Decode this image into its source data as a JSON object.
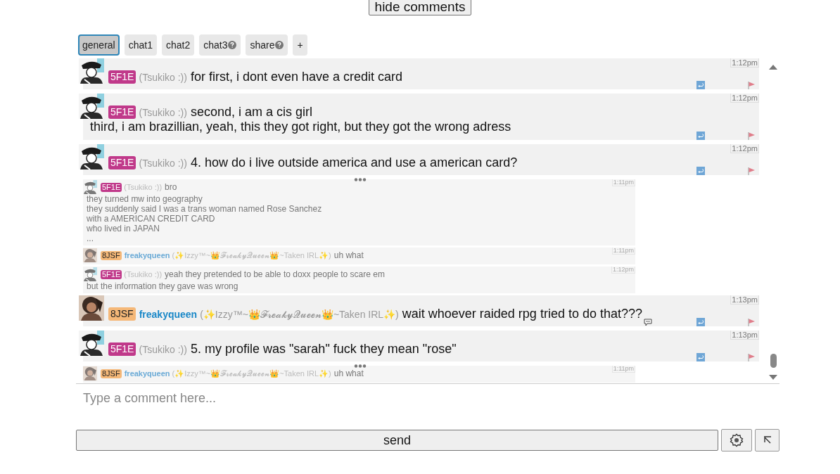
{
  "toggle_button": "hide comments",
  "tabs": [
    {
      "label": "general",
      "help": false,
      "selected": true
    },
    {
      "label": "chat1",
      "help": false,
      "selected": false
    },
    {
      "label": "chat2",
      "help": false,
      "selected": false
    },
    {
      "label": "chat3",
      "help": true,
      "selected": false
    },
    {
      "label": "share",
      "help": true,
      "selected": false
    },
    {
      "label": "+",
      "help": false,
      "selected": false
    }
  ],
  "messages": [
    {
      "kind": "main",
      "badge": "5F1E",
      "color": "#c0398a",
      "display_name": "(Tsukiko :))",
      "time": "1:12pm",
      "lines": [
        "for first, i dont even have a credit card"
      ],
      "comment_icon": false
    },
    {
      "kind": "main",
      "badge": "5F1E",
      "color": "#c0398a",
      "display_name": "(Tsukiko :))",
      "time": "1:12pm",
      "lines": [
        "second, i am a cis girl",
        "third, i am brazillian, yeah, this they got right, but they got the wrong adress"
      ],
      "comment_icon": false
    },
    {
      "kind": "main",
      "badge": "5F1E",
      "color": "#c0398a",
      "display_name": "(Tsukiko :))",
      "time": "1:12pm",
      "lines": [
        "4. how do i live outside america and use a american card?"
      ],
      "comment_icon": false
    },
    {
      "kind": "quoted",
      "badge": "5F1E",
      "color": "#c0398a",
      "display_name": "(Tsukiko :))",
      "time": "1:11pm",
      "lines": [
        "bro",
        "they turned mw into geography",
        "they suddenly said I was a trans woman named Rose Sanchez",
        "with a AMERICAN CREDIT CARD",
        "who lived in JAPAN",
        "..."
      ],
      "more_handle": true
    },
    {
      "kind": "quoted",
      "badge": "8JSF",
      "color": "#f5b878",
      "username": "freakyqueen",
      "display_name": "(✨Izzy™~👑𝓕𝓻𝓮𝓪𝓴𝔂𝓠𝓾𝓮𝓮𝓷👑~Taken IRL✨)",
      "time": "1:11pm",
      "lines": [
        "uh what"
      ],
      "more_handle": false
    },
    {
      "kind": "quoted",
      "badge": "5F1E",
      "color": "#c0398a",
      "display_name": "(Tsukiko :))",
      "time": "1:12pm",
      "lines": [
        "yeah they pretended to be able to doxx people to scare em",
        "but the information they gave was wrong"
      ],
      "more_handle": false
    },
    {
      "kind": "main",
      "badge": "8JSF",
      "color": "#f5b878",
      "username": "freakyqueen",
      "display_name": "(✨Izzy™~👑𝓕𝓻𝓮𝓪𝓴𝔂𝓠𝓾𝓮𝓮𝓷👑~Taken IRL✨)",
      "time": "1:13pm",
      "lines": [
        "wait whoever raided rpg tried to do that???"
      ],
      "comment_icon": true
    },
    {
      "kind": "main",
      "badge": "5F1E",
      "color": "#c0398a",
      "display_name": "(Tsukiko :))",
      "time": "1:13pm",
      "lines": [
        "5. my profile was \"sarah\" fuck they mean \"rose\""
      ],
      "comment_icon": false
    },
    {
      "kind": "quoted",
      "badge": "8JSF",
      "color": "#f5b878",
      "username": "freakyqueen",
      "display_name": "(✨Izzy™~👑𝓕𝓻𝓮𝓪𝓴𝔂𝓠𝓾𝓮𝓮𝓷👑~Taken IRL✨)",
      "time": "1:11pm",
      "lines": [
        "uh what"
      ],
      "more_handle": true
    }
  ],
  "composer": {
    "placeholder": "Type a comment here..."
  },
  "send_button": "send"
}
